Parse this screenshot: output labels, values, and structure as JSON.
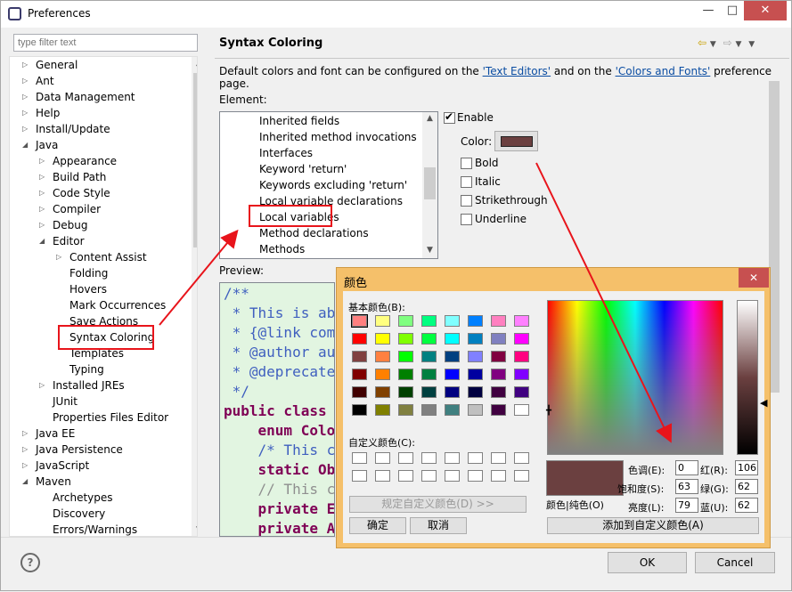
{
  "window": {
    "title": "Preferences",
    "min": "—",
    "max": "□",
    "close": "✕"
  },
  "filter": {
    "placeholder": "type filter text"
  },
  "tree": [
    {
      "label": "General",
      "level": 0,
      "twisty": "▷"
    },
    {
      "label": "Ant",
      "level": 0,
      "twisty": "▷"
    },
    {
      "label": "Data Management",
      "level": 0,
      "twisty": "▷"
    },
    {
      "label": "Help",
      "level": 0,
      "twisty": "▷"
    },
    {
      "label": "Install/Update",
      "level": 0,
      "twisty": "▷"
    },
    {
      "label": "Java",
      "level": 0,
      "twisty": "◢"
    },
    {
      "label": "Appearance",
      "level": 1,
      "twisty": "▷"
    },
    {
      "label": "Build Path",
      "level": 1,
      "twisty": "▷"
    },
    {
      "label": "Code Style",
      "level": 1,
      "twisty": "▷"
    },
    {
      "label": "Compiler",
      "level": 1,
      "twisty": "▷"
    },
    {
      "label": "Debug",
      "level": 1,
      "twisty": "▷"
    },
    {
      "label": "Editor",
      "level": 1,
      "twisty": "◢"
    },
    {
      "label": "Content Assist",
      "level": 2,
      "twisty": "▷"
    },
    {
      "label": "Folding",
      "level": 2,
      "twisty": ""
    },
    {
      "label": "Hovers",
      "level": 2,
      "twisty": ""
    },
    {
      "label": "Mark Occurrences",
      "level": 2,
      "twisty": ""
    },
    {
      "label": "Save Actions",
      "level": 2,
      "twisty": ""
    },
    {
      "label": "Syntax Coloring",
      "level": 2,
      "twisty": ""
    },
    {
      "label": "Templates",
      "level": 2,
      "twisty": ""
    },
    {
      "label": "Typing",
      "level": 2,
      "twisty": ""
    },
    {
      "label": "Installed JREs",
      "level": 1,
      "twisty": "▷"
    },
    {
      "label": "JUnit",
      "level": 1,
      "twisty": ""
    },
    {
      "label": "Properties Files Editor",
      "level": 1,
      "twisty": ""
    },
    {
      "label": "Java EE",
      "level": 0,
      "twisty": "▷"
    },
    {
      "label": "Java Persistence",
      "level": 0,
      "twisty": "▷"
    },
    {
      "label": "JavaScript",
      "level": 0,
      "twisty": "▷"
    },
    {
      "label": "Maven",
      "level": 0,
      "twisty": "◢"
    },
    {
      "label": "Archetypes",
      "level": 1,
      "twisty": ""
    },
    {
      "label": "Discovery",
      "level": 1,
      "twisty": ""
    },
    {
      "label": "Errors/Warnings",
      "level": 1,
      "twisty": ""
    }
  ],
  "page": {
    "title": "Syntax Coloring",
    "desc_pre": "Default colors and font can be configured on the ",
    "link1": "'Text Editors'",
    "desc_mid": " and on the ",
    "link2": "'Colors and Fonts'",
    "desc_post": " preference page.",
    "element_label": "Element:",
    "preview_label": "Preview:"
  },
  "elements": [
    "Inherited fields",
    "Inherited method invocations",
    "Interfaces",
    "Keyword 'return'",
    "Keywords excluding 'return'",
    "Local variable declarations",
    "Local variables",
    "Method declarations",
    "Methods"
  ],
  "options": {
    "enable": "Enable",
    "color_label": "Color:",
    "color_value": "#6b4040",
    "bold": "Bold",
    "italic": "Italic",
    "strikethrough": "Strikethrough",
    "underline": "Underline"
  },
  "preview_lines": [
    {
      "text": "/**",
      "cls": "cm"
    },
    {
      "text": " * This is ab",
      "cls": "cm"
    },
    {
      "text": " * {@link com",
      "cls": "cm"
    },
    {
      "text": " * @author au",
      "cls": "cm"
    },
    {
      "text": " * @deprecate",
      "cls": "cm"
    },
    {
      "text": " */",
      "cls": "cm"
    },
    {
      "text": "public class ",
      "cls": "kw"
    },
    {
      "text": "    enum Colo",
      "cls": "kw"
    },
    {
      "text": "    /* This c",
      "cls": "cm"
    },
    {
      "text": "    static Ob",
      "cls": "kw"
    },
    {
      "text": "    // This c",
      "cls": "gr"
    },
    {
      "text": "    private E",
      "cls": "kw"
    },
    {
      "text": "    private A",
      "cls": "kw"
    }
  ],
  "buttons": {
    "ok": "OK",
    "cancel": "Cancel",
    "help": "?"
  },
  "color_dialog": {
    "title": "颜色",
    "basic_colors": "基本颜色(B):",
    "custom_colors": "自定义颜色(C):",
    "define_custom": "规定自定义颜色(D) >>",
    "ok": "确定",
    "cancel": "取消",
    "color_solid": "颜色|纯色(O)",
    "add_custom": "添加到自定义颜色(A)",
    "hue_label": "色调(E):",
    "hue": "0",
    "sat_label": "饱和度(S):",
    "sat": "63",
    "lum_label": "亮度(L):",
    "lum": "79",
    "red_label": "红(R):",
    "red": "106",
    "green_label": "绿(G):",
    "green": "62",
    "blue_label": "蓝(U):",
    "blue": "62",
    "palette": [
      [
        "#ff8080",
        "#ffff80",
        "#80ff80",
        "#00ff80",
        "#80ffff",
        "#0080ff",
        "#ff80c0",
        "#ff80ff"
      ],
      [
        "#ff0000",
        "#ffff00",
        "#80ff00",
        "#00ff40",
        "#00ffff",
        "#0080c0",
        "#8080c0",
        "#ff00ff"
      ],
      [
        "#804040",
        "#ff8040",
        "#00ff00",
        "#008080",
        "#004080",
        "#8080ff",
        "#800040",
        "#ff0080"
      ],
      [
        "#800000",
        "#ff8000",
        "#008000",
        "#008040",
        "#0000ff",
        "#0000a0",
        "#800080",
        "#8000ff"
      ],
      [
        "#400000",
        "#804000",
        "#004000",
        "#004040",
        "#000080",
        "#000040",
        "#400040",
        "#400080"
      ],
      [
        "#000000",
        "#808000",
        "#808040",
        "#808080",
        "#408080",
        "#c0c0c0",
        "#400040",
        "#ffffff"
      ]
    ]
  }
}
